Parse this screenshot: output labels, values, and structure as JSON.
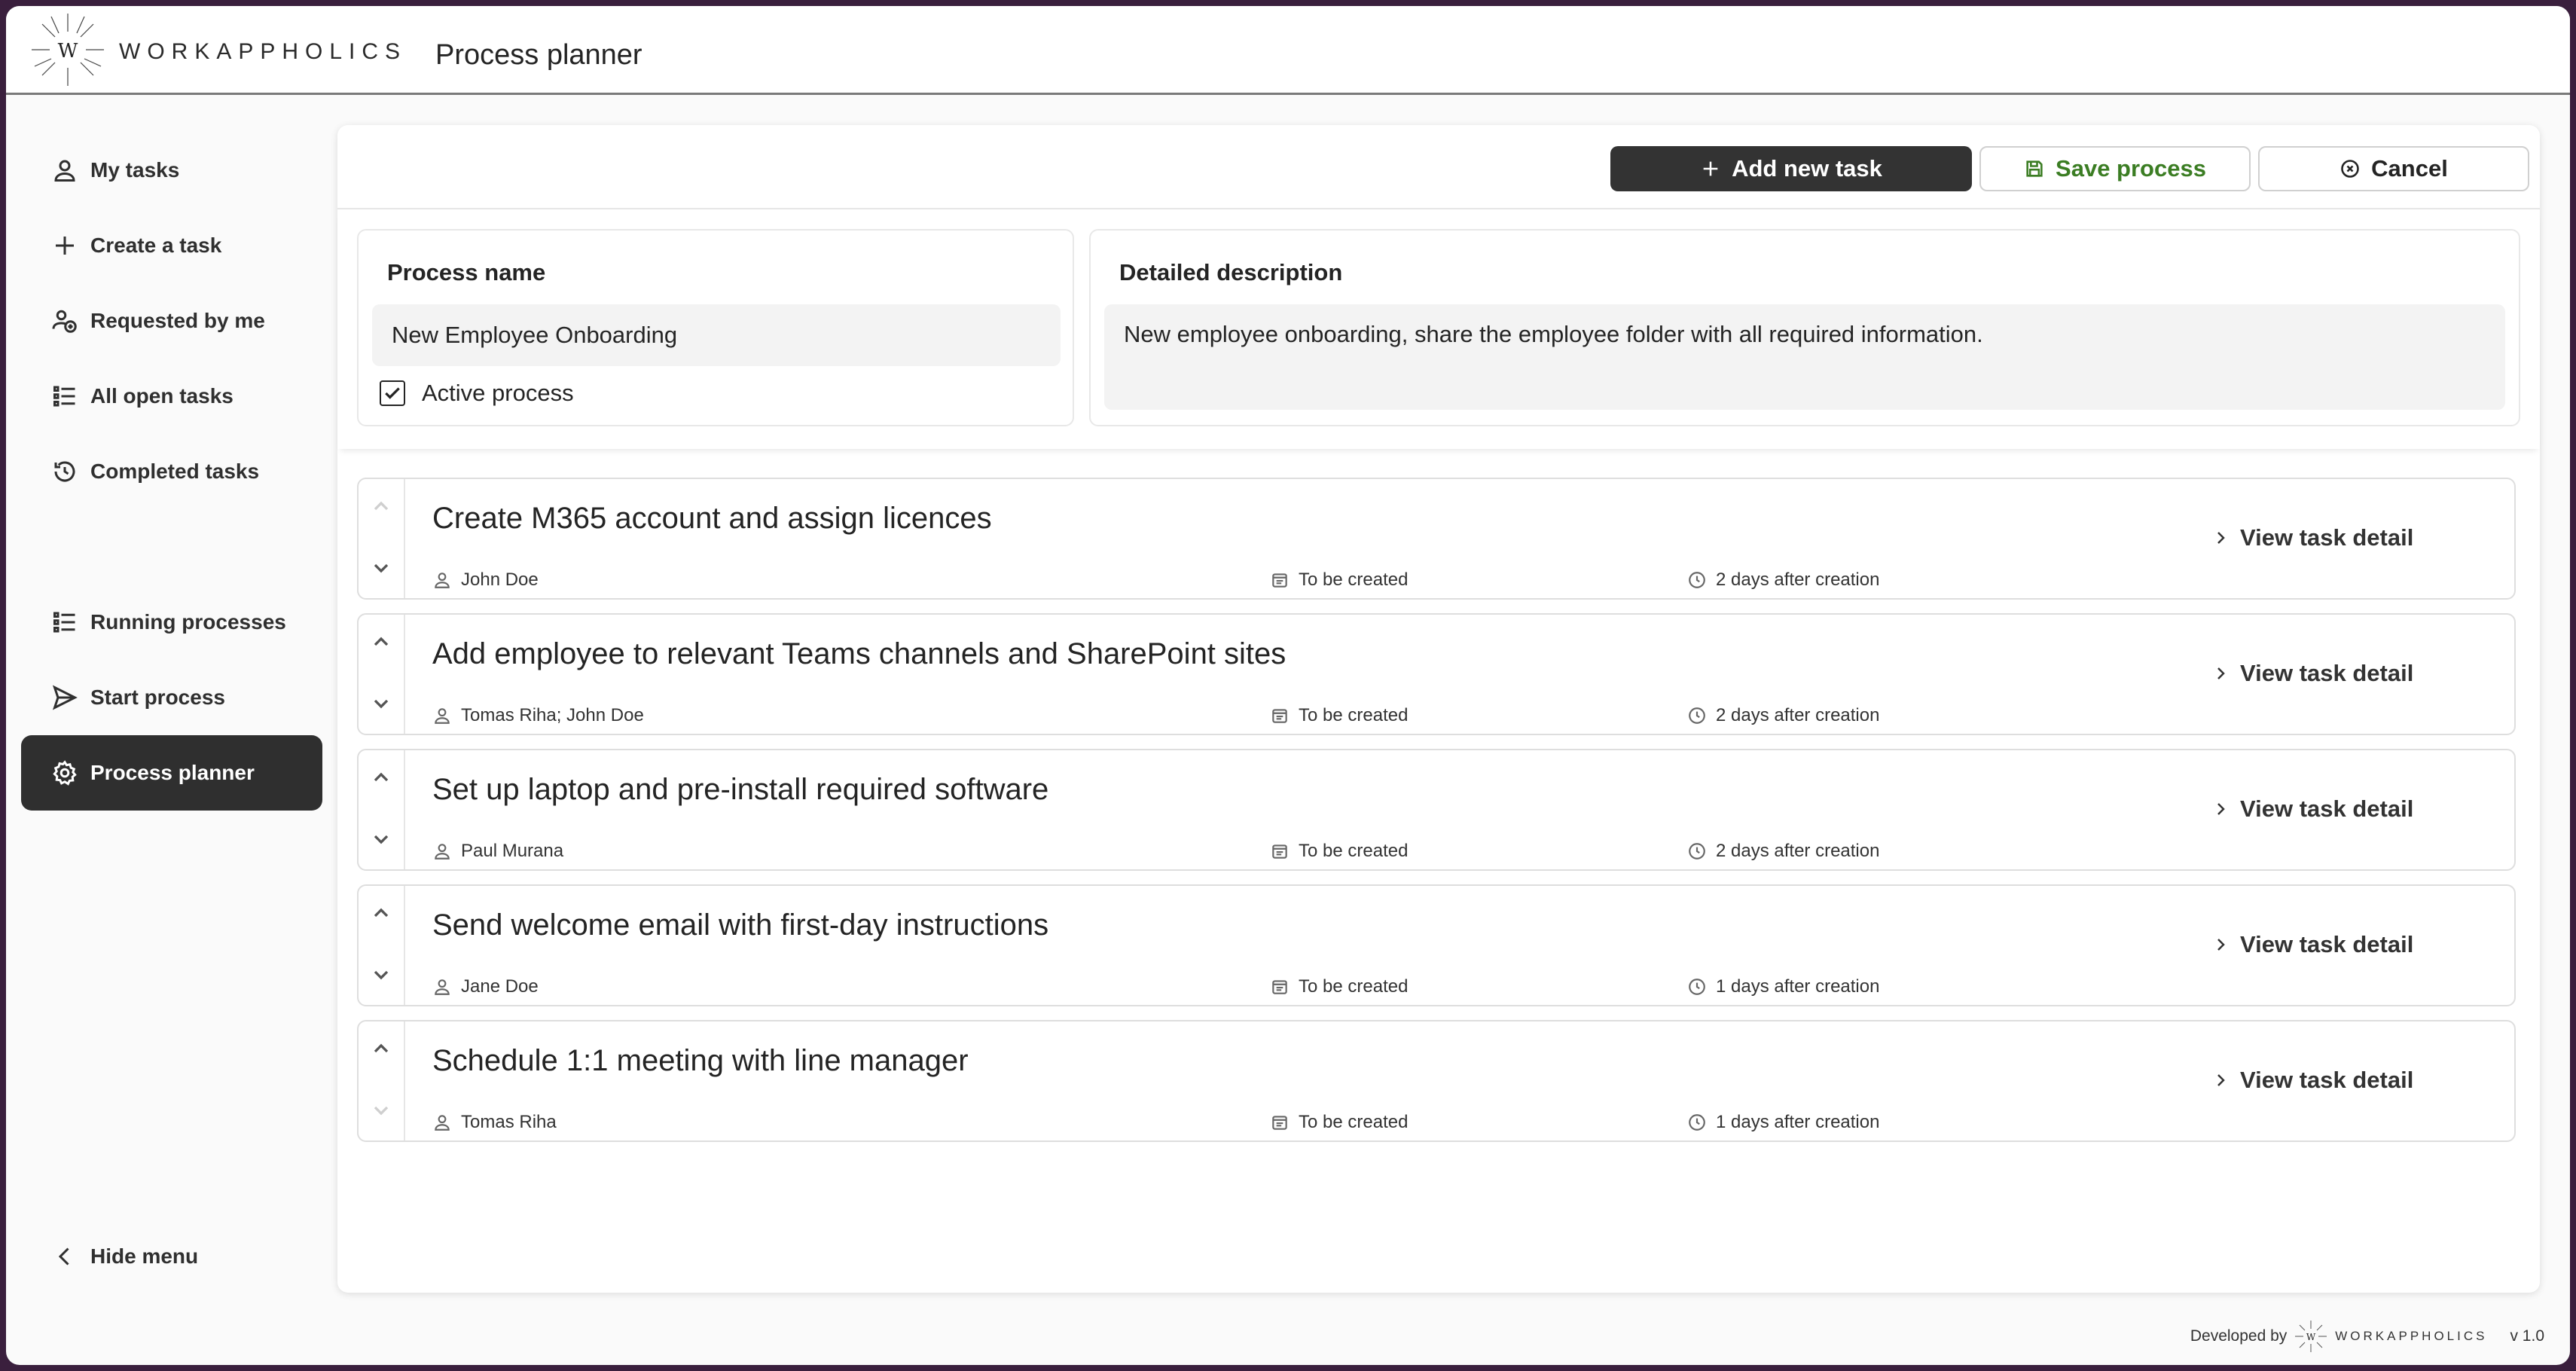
{
  "header": {
    "brand": "WORKAPPHOLICS",
    "logo_letter": "W",
    "title": "Process planner"
  },
  "sidebar": {
    "items": [
      {
        "label": "My tasks",
        "icon": "person-icon"
      },
      {
        "label": "Create a task",
        "icon": "plus-icon"
      },
      {
        "label": "Requested by me",
        "icon": "people-add-icon"
      },
      {
        "label": "All open tasks",
        "icon": "list-icon"
      },
      {
        "label": "Completed tasks",
        "icon": "history-icon"
      },
      {
        "label": "Running processes",
        "icon": "list-icon"
      },
      {
        "label": "Start process",
        "icon": "send-icon"
      },
      {
        "label": "Process planner",
        "icon": "gear-icon"
      }
    ],
    "active": "Process planner",
    "hide_menu": "Hide menu"
  },
  "toolbar": {
    "add_label": "Add new task",
    "save_label": "Save process",
    "cancel_label": "Cancel"
  },
  "form": {
    "name_label": "Process name",
    "name_value": "New Employee Onboarding",
    "active_label": "Active process",
    "active_checked": true,
    "desc_label": "Detailed description",
    "desc_value": "New employee onboarding, share the employee folder with all required information."
  },
  "tasks": [
    {
      "title": "Create M365 account and assign licences",
      "assignee": "John Doe",
      "status": "To be created",
      "due": "2 days after creation",
      "link": "View task detail"
    },
    {
      "title": "Add employee to relevant Teams channels and SharePoint sites",
      "assignee": "Tomas Riha; John Doe",
      "status": "To be created",
      "due": "2 days after creation",
      "link": "View task detail"
    },
    {
      "title": "Set up laptop and pre-install required software",
      "assignee": "Paul Murana",
      "status": "To be created",
      "due": "2 days after creation",
      "link": "View task detail"
    },
    {
      "title": "Send welcome email with first-day instructions",
      "assignee": "Jane Doe",
      "status": "To be created",
      "due": "1 days after creation",
      "link": "View task detail"
    },
    {
      "title": "Schedule 1:1 meeting with line manager",
      "assignee": "Tomas Riha",
      "status": "To be created",
      "due": "1 days after creation",
      "link": "View task detail"
    }
  ],
  "footer": {
    "developed_by": "Developed by",
    "brand": "WORKAPPHOLICS",
    "version": "v 1.0"
  },
  "colors": {
    "active_nav": "#2f2f2f",
    "save_accent": "#3b7d23",
    "frame": "#3a1f3d"
  }
}
